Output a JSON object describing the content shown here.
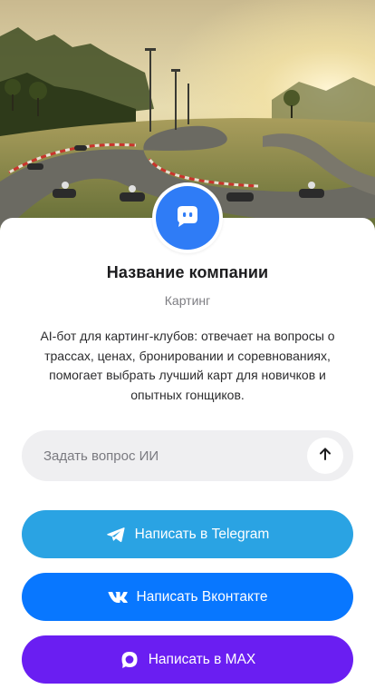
{
  "hero": {
    "image": "go-kart race track at sunset illustration"
  },
  "profile": {
    "avatar_icon": "chat-bot-icon",
    "company_name": "Название компании",
    "category": "Картинг",
    "description": "AI-бот для картинг-клубов: отвечает на вопросы о трассах, ценах, бронировании и соревнованиях, помогает выбрать лучший карт для новичков и опытных гонщиков."
  },
  "ask": {
    "placeholder": "Задать вопрос ИИ",
    "value": "",
    "send_icon": "arrow-up-icon"
  },
  "actions": {
    "telegram": {
      "label": "Написать в Telegram",
      "icon": "telegram-icon",
      "color": "#2aa3e3"
    },
    "vk": {
      "label": "Написать Вконтакте",
      "icon": "vk-icon",
      "color": "#0877ff"
    },
    "max": {
      "label": "Написать в MAX",
      "icon": "max-icon",
      "color": "#6a1ef2"
    }
  },
  "colors": {
    "accent": "#2f7cf6"
  }
}
